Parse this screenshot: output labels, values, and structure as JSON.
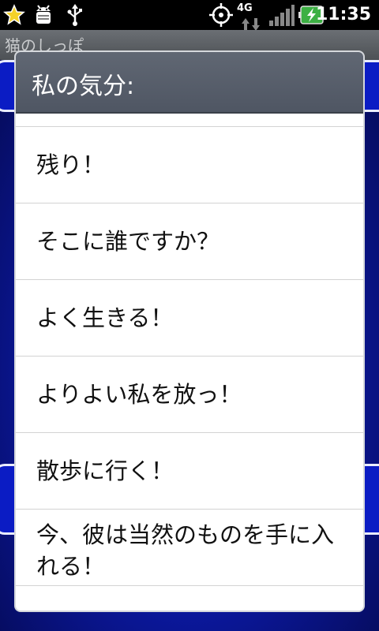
{
  "status_bar": {
    "time": "11:35",
    "network_label": "4G",
    "icons": [
      "star-notification-icon",
      "android-debug-icon",
      "usb-icon",
      "gps-icon",
      "signal-bars-icon",
      "battery-charging-icon"
    ]
  },
  "app": {
    "title": "猫のしっぽ"
  },
  "dialog": {
    "title": "私の気分:",
    "items": [
      {
        "label": "残り！"
      },
      {
        "label": "そこに誰ですか？"
      },
      {
        "label": "よく生きる！"
      },
      {
        "label": "よりよい私を放っ！"
      },
      {
        "label": "散歩に行く！"
      },
      {
        "label": "今、彼は当然のものを手に入れる！"
      }
    ]
  },
  "colors": {
    "dialog_header": "#555c68",
    "app_background": "#0c1aa8",
    "battery": "#3cb043"
  }
}
